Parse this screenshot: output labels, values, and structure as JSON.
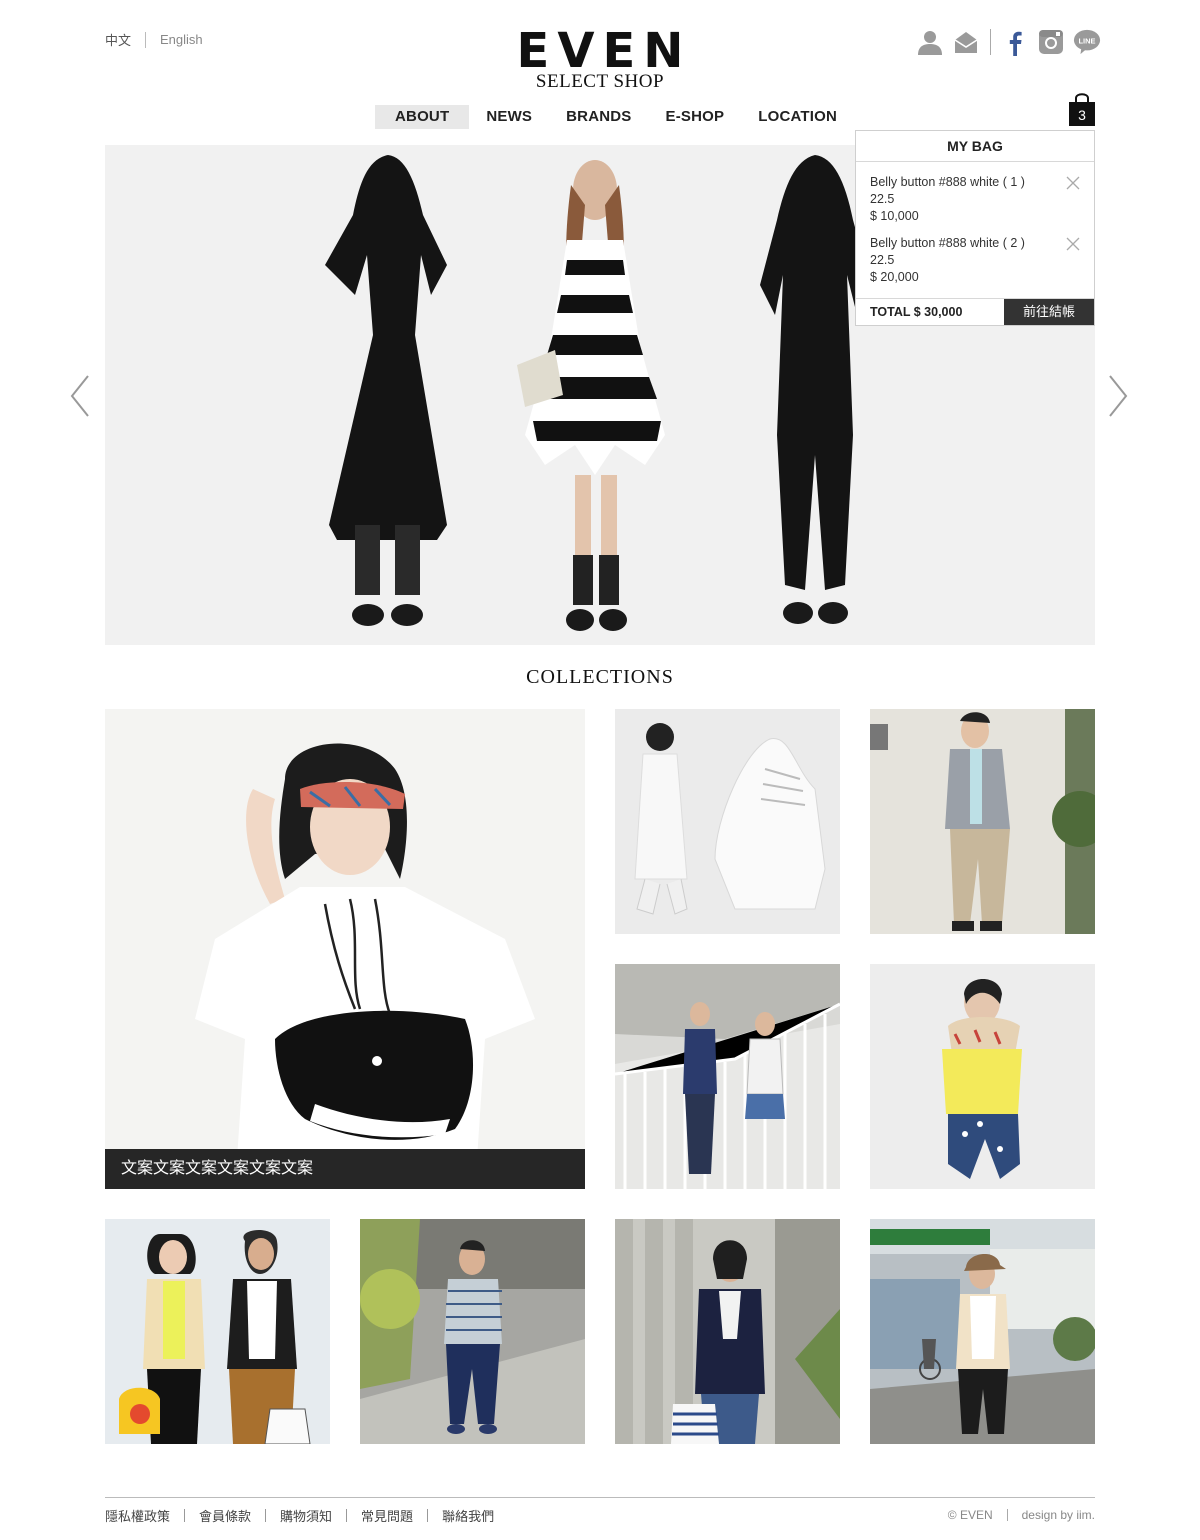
{
  "header": {
    "lang_zh": "中文",
    "lang_en": "English",
    "logo_main": "EVEN",
    "logo_sub": "SELECT SHOP",
    "icons": [
      "user-icon",
      "mail-icon",
      "facebook-icon",
      "instagram-icon",
      "line-icon"
    ]
  },
  "nav": {
    "items": [
      "ABOUT",
      "NEWS",
      "BRANDS",
      "E-SHOP",
      "LOCATION"
    ],
    "active": "ABOUT"
  },
  "bag": {
    "count": "3",
    "title": "MY BAG",
    "items": [
      {
        "name": "Belly button #888 white ( 1 )",
        "size": "22.5",
        "price": "$ 10,000"
      },
      {
        "name": "Belly button #888 white ( 2 )",
        "size": "22.5",
        "price": "$ 20,000"
      }
    ],
    "total": "TOTAL $ 30,000",
    "checkout": "前往結帳"
  },
  "collections": {
    "title": "COLLECTIONS",
    "featured_caption": "文案文案文案文案文案文案"
  },
  "footer": {
    "links": [
      "隱私權政策",
      "會員條款",
      "購物須知",
      "常見問題",
      "聯絡我們"
    ],
    "copyright": "© EVEN",
    "credit": "design by iim."
  },
  "colors": {
    "nav_active_bg": "#e8e8e8",
    "caption_bg": "#262626",
    "checkout_bg": "#333333",
    "facebook": "#3b5998"
  }
}
